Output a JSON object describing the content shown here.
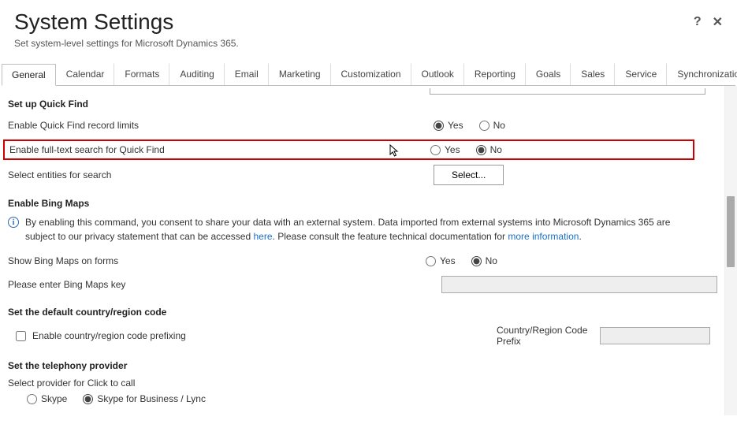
{
  "header": {
    "title": "System Settings",
    "subtitle": "Set system-level settings for Microsoft Dynamics 365.",
    "help_icon": "?",
    "close_icon": "✕"
  },
  "tabs": [
    "General",
    "Calendar",
    "Formats",
    "Auditing",
    "Email",
    "Marketing",
    "Customization",
    "Outlook",
    "Reporting",
    "Goals",
    "Sales",
    "Service",
    "Synchronization"
  ],
  "active_tab": "General",
  "quickfind": {
    "heading": "Set up Quick Find",
    "record_limits_label": "Enable Quick Find record limits",
    "record_limits_value": "Yes",
    "fulltext_label": "Enable full-text search for Quick Find",
    "fulltext_value": "No",
    "select_entities_label": "Select entities for search",
    "select_button": "Select..."
  },
  "bingmaps": {
    "heading": "Enable Bing Maps",
    "info_text_1": "By enabling this command, you consent to share your data with an external system. Data imported from external systems into Microsoft Dynamics 365 are subject to our privacy statement that can be accessed ",
    "info_link_here": "here",
    "info_text_2": ". Please consult the feature technical documentation for ",
    "info_link_more": "more information",
    "show_label": "Show Bing Maps on forms",
    "show_value": "No",
    "key_label": "Please enter Bing Maps key",
    "key_value": ""
  },
  "country": {
    "heading": "Set the default country/region code",
    "enable_label": "Enable country/region code prefixing",
    "enable_value": false,
    "prefix_label": "Country/Region Code Prefix",
    "prefix_value": ""
  },
  "telephony": {
    "heading": "Set the telephony provider",
    "select_label": "Select provider for Click to call",
    "options": {
      "skype": "Skype",
      "sfb": "Skype for Business / Lync"
    },
    "value": "sfb"
  },
  "radio_labels": {
    "yes": "Yes",
    "no": "No"
  }
}
